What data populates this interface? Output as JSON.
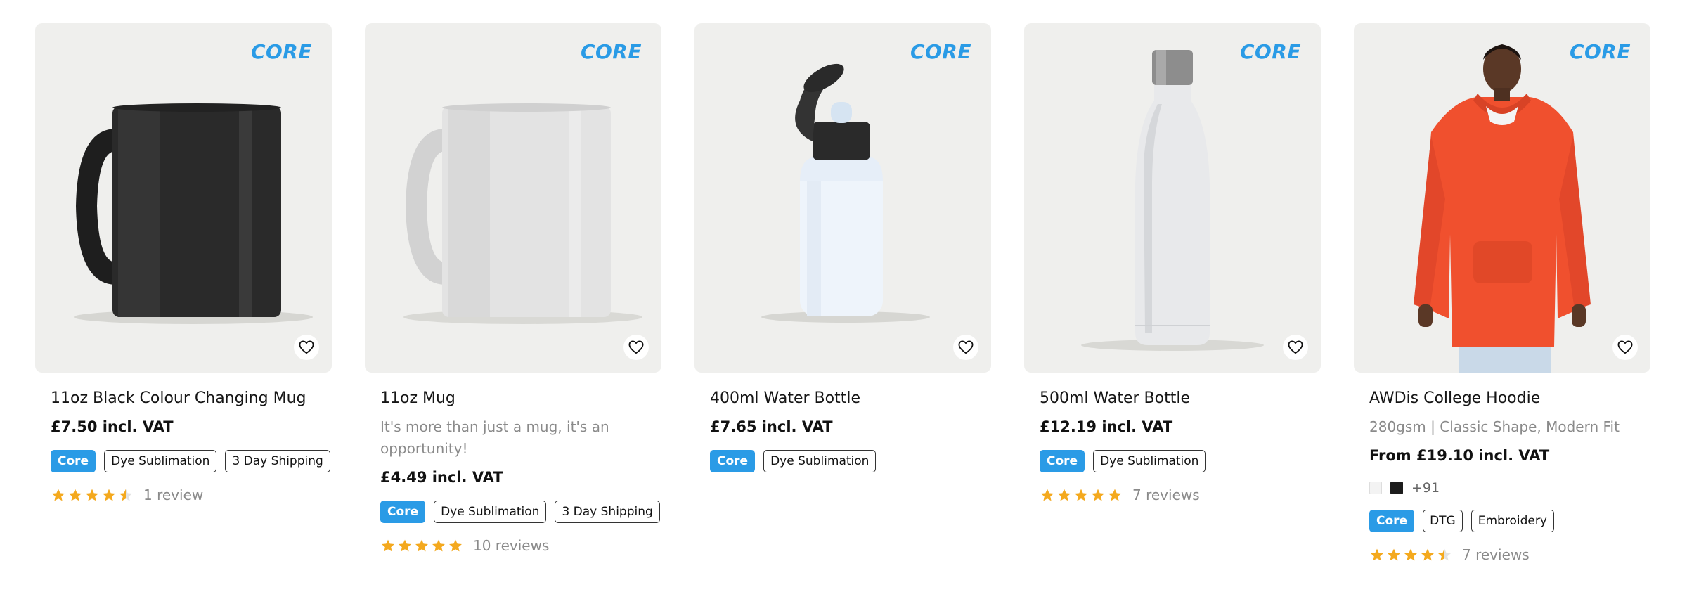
{
  "colors": {
    "accent": "#2a9be6",
    "star": "#f4a91e",
    "image_bg": "#efefed"
  },
  "products": [
    {
      "brand_logo": "CORE",
      "title": "11oz Black Colour Changing Mug",
      "price": "£7.50 incl. VAT",
      "tags": [
        "Core",
        "Dye Sublimation",
        "3 Day Shipping"
      ],
      "rating": 4.5,
      "reviews": "1 review",
      "image_icon": "black-mug"
    },
    {
      "brand_logo": "CORE",
      "title": "11oz Mug",
      "subtitle": "It's more than just a mug, it's an opportunity!",
      "price": "£4.49 incl. VAT",
      "tags": [
        "Core",
        "Dye Sublimation",
        "3 Day Shipping"
      ],
      "rating": 5,
      "reviews": "10 reviews",
      "image_icon": "white-mug"
    },
    {
      "brand_logo": "CORE",
      "title": "400ml Water Bottle",
      "price": "£7.65 incl. VAT",
      "tags": [
        "Core",
        "Dye Sublimation"
      ],
      "image_icon": "sports-bottle"
    },
    {
      "brand_logo": "CORE",
      "title": "500ml Water Bottle",
      "price": "£12.19 incl. VAT",
      "tags": [
        "Core",
        "Dye Sublimation"
      ],
      "rating": 5,
      "reviews": "7 reviews",
      "image_icon": "steel-bottle"
    },
    {
      "brand_logo": "CORE",
      "title": "AWDis College Hoodie",
      "subtitle": "280gsm | Classic Shape, Modern Fit",
      "price": "From £19.10 incl. VAT",
      "swatches": [
        "#f3f3f3",
        "#1c1c1c"
      ],
      "swatch_more": "+91",
      "tags": [
        "Core",
        "DTG",
        "Embroidery"
      ],
      "rating": 4.5,
      "reviews": "7 reviews",
      "image_icon": "orange-hoodie"
    }
  ]
}
